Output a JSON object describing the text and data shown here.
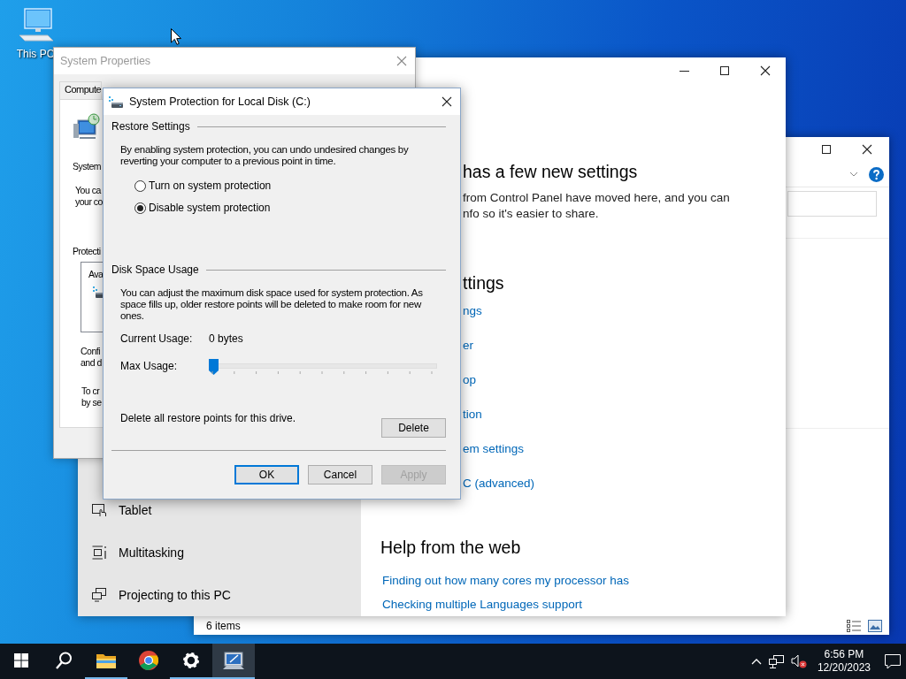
{
  "desktop": {
    "icons": [
      {
        "label": "This PC"
      }
    ]
  },
  "explorer_window": {
    "status_text": "6 items"
  },
  "settings_window": {
    "sidebar_items": [
      {
        "label": "Tablet",
        "kind": "tablet"
      },
      {
        "label": "Multitasking",
        "kind": "multitasking"
      },
      {
        "label": "Projecting to this PC",
        "kind": "projecting"
      }
    ],
    "heading": "has a few new settings",
    "paragraph_lines": [
      "from Control Panel have moved here, and you can",
      "nfo so it's easier to share."
    ],
    "related_heading": "ttings",
    "related_links": [
      "ngs",
      "er",
      "op",
      "tion",
      "em settings",
      "C (advanced)"
    ],
    "help_heading": "Help from the web",
    "help_links": [
      "Finding out how many cores my processor has",
      "Checking multiple Languages support"
    ]
  },
  "system_properties": {
    "title": "System Properties",
    "tabs": [
      {
        "label": "Compute",
        "selected": false
      }
    ],
    "section_label": "System",
    "text_lines": [
      "You ca",
      "your co"
    ],
    "protection_label": "Protecti",
    "list_header": "Ava",
    "config_lines": [
      "Confi",
      "and d"
    ],
    "create_lines": [
      "To cr",
      "by se"
    ]
  },
  "dialog": {
    "title": "System Protection for Local Disk (C:)",
    "restore_group": "Restore Settings",
    "restore_lines": [
      "By enabling system protection, you can undo undesired changes by",
      "reverting your computer to a previous point in time."
    ],
    "options": [
      {
        "label": "Turn on system protection",
        "selected": false
      },
      {
        "label": "Disable system protection",
        "selected": true
      }
    ],
    "disk_group": "Disk Space Usage",
    "disk_lines": [
      "You can adjust the maximum disk space used for system protection. As",
      "space fills up, older restore points will be deleted to make room for new",
      "ones."
    ],
    "current_usage_label": "Current Usage:",
    "current_usage_value": "0 bytes",
    "max_usage_label": "Max Usage:",
    "max_usage": {
      "level": 0
    },
    "delete_text": "Delete all restore points for this drive.",
    "delete_button": "Delete",
    "buttons": [
      {
        "label": "OK",
        "default": true,
        "disabled": false
      },
      {
        "label": "Cancel",
        "default": false,
        "disabled": false
      },
      {
        "label": "Apply",
        "default": false,
        "disabled": true
      }
    ]
  },
  "taskbar": {
    "items": [
      {
        "kind": "start",
        "running": false,
        "active": false
      },
      {
        "kind": "search",
        "running": false,
        "active": false
      },
      {
        "kind": "explorer",
        "running": true,
        "active": false
      },
      {
        "kind": "chrome",
        "running": false,
        "active": false
      },
      {
        "kind": "settings",
        "running": true,
        "active": false
      },
      {
        "kind": "system",
        "running": true,
        "active": true
      }
    ],
    "time": "6:56 PM",
    "date": "12/20/2023"
  }
}
